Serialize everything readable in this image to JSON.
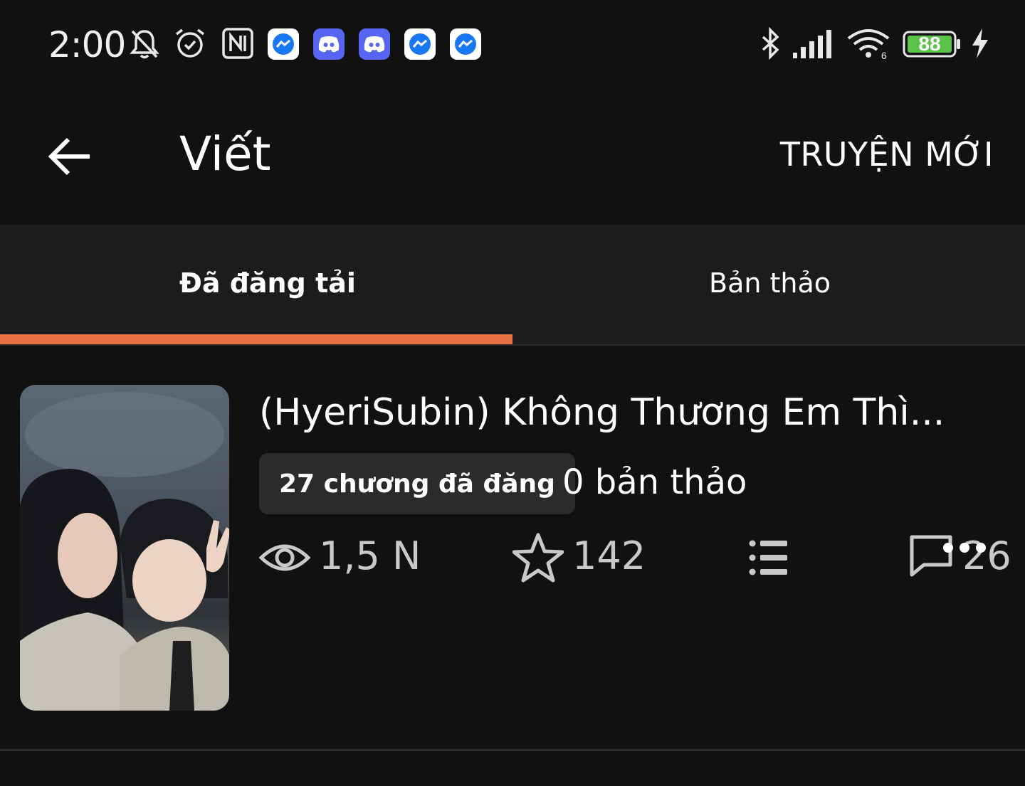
{
  "status_bar": {
    "time": "2:00",
    "battery_level": "88",
    "icons": [
      "mute-icon",
      "alarm-icon",
      "nfc-icon",
      "messenger-icon",
      "discord-icon",
      "discord-icon",
      "messenger-icon",
      "messenger-icon",
      "bluetooth-icon",
      "signal-icon",
      "wifi-icon",
      "battery-icon",
      "charging-icon"
    ]
  },
  "appbar": {
    "title": "Viết",
    "action_label": "TRUYỆN MỚI"
  },
  "tabs": [
    {
      "label": "Đã đăng tải",
      "active": true
    },
    {
      "label": "Bản thảo",
      "active": false
    }
  ],
  "story": {
    "title": "(HyeriSubin) Không Thương Em Thì...",
    "published_chip": "27 chương đã đăng",
    "drafts": "0 bản thảo",
    "views": "1,5 N",
    "votes": "142",
    "comments": "26"
  },
  "colors": {
    "background": "#111112",
    "tab_background": "#1c1c1d",
    "accent": "#e67246",
    "chip": "#2b2b2c",
    "battery": "#5cc34a"
  }
}
